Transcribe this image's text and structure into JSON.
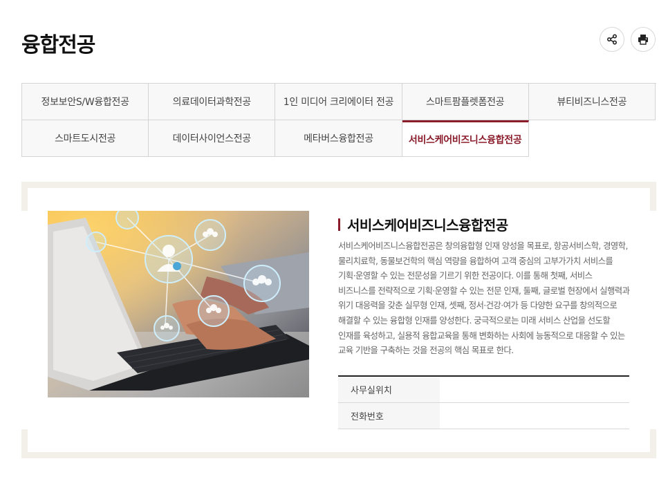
{
  "page": {
    "title": "융합전공"
  },
  "toolbar": {
    "share_icon": "share-icon",
    "print_icon": "print-icon"
  },
  "tabs": [
    {
      "label": "정보보안S/W융합전공",
      "active": false
    },
    {
      "label": "의료데이터과학전공",
      "active": false
    },
    {
      "label": "1인 미디어 크리에이터 전공",
      "active": false
    },
    {
      "label": "스마트팜플렛폼전공",
      "active": false
    },
    {
      "label": "뷰티비즈니스전공",
      "active": false
    },
    {
      "label": "스마트도시전공",
      "active": false
    },
    {
      "label": "데이터사이언스전공",
      "active": false
    },
    {
      "label": "메타버스융합전공",
      "active": false
    },
    {
      "label": "서비스케어비즈니스융합전공",
      "active": true
    }
  ],
  "content": {
    "title": "서비스케어비즈니스융합전공",
    "description": "서비스케어비즈니스융합전공은 창의융합형 인재 양성을 목표로, 항공서비스학, 경영학, 물리치료학, 동물보건학의 핵심 역량을 융합하여 고객 중심의 고부가가치 서비스를 기획·운영할 수 있는 전문성을 기르기 위한 전공이다. 이를 통해 첫째, 서비스 비즈니스를 전략적으로 기획·운영할 수 있는 전문 인재, 둘째, 글로벌 현장에서 실행력과 위기 대응력을 갖춘 실무형 인재, 셋째, 정서·건강·여가 등 다양한 요구를 창의적으로 해결할 수 있는 융합형 인재를 양성한다. 궁극적으로는 미래 서비스 산업을 선도할 인재를 육성하고, 실용적 융합교육을 통해 변화하는 사회에 능동적으로 대응할 수 있는 교육 기반을 구축하는 것을 전공의 핵심 목표로 한다.",
    "info": [
      {
        "label": "사무실위치",
        "value": ""
      },
      {
        "label": "전화번호",
        "value": ""
      }
    ]
  },
  "colors": {
    "accent": "#8a1c2b",
    "frame": "#f3efe9"
  }
}
